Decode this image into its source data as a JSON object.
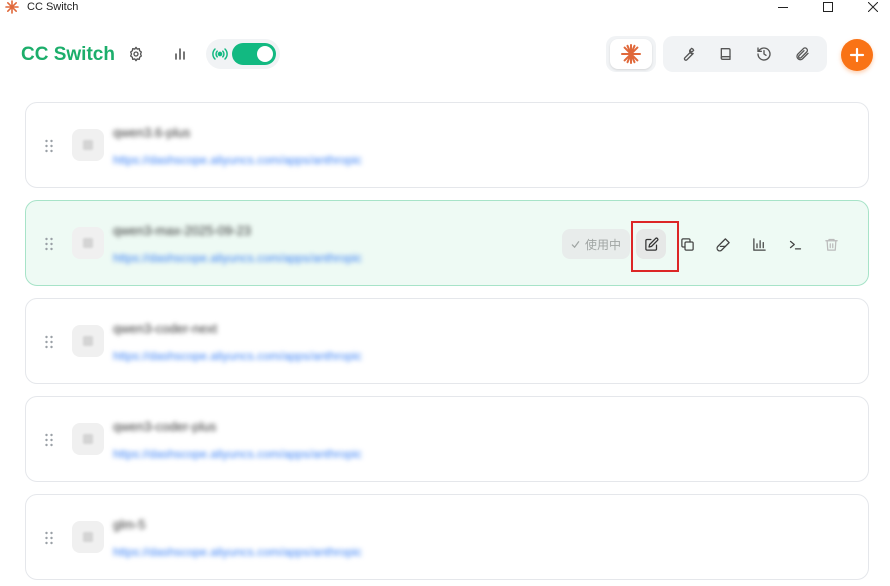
{
  "window": {
    "title": "CC Switch"
  },
  "header": {
    "brand": "CC Switch",
    "toggle_on": true
  },
  "colors": {
    "brand": "#1cae6b",
    "toggle": "#12b981",
    "add": "#f97316",
    "claude": "#e0693b",
    "highlight": "#dc2626"
  },
  "icons": {
    "settings": "gear-icon",
    "stats": "bar-chart-icon",
    "proxy": "broadcast-icon",
    "claude": "claude-sparkle-icon",
    "tools": [
      "wrench-icon",
      "book-icon",
      "history-icon",
      "paperclip-icon"
    ],
    "add": "plus-icon"
  },
  "providers": [
    {
      "name": "qwen3.6-plus",
      "url": "https://dashscope.aliyuncs.com/apps/anthropic",
      "active": false
    },
    {
      "name": "qwen3-max-2025-09-23",
      "url": "https://dashscope.aliyuncs.com/apps/anthropic",
      "active": true,
      "status_label": "使用中"
    },
    {
      "name": "qwen3-coder-next",
      "url": "https://dashscope.aliyuncs.com/apps/anthropic",
      "active": false
    },
    {
      "name": "qwen3-coder-plus",
      "url": "https://dashscope.aliyuncs.com/apps/anthropic",
      "active": false
    },
    {
      "name": "glm-5",
      "url": "https://dashscope.aliyuncs.com/apps/anthropic",
      "active": false
    }
  ]
}
